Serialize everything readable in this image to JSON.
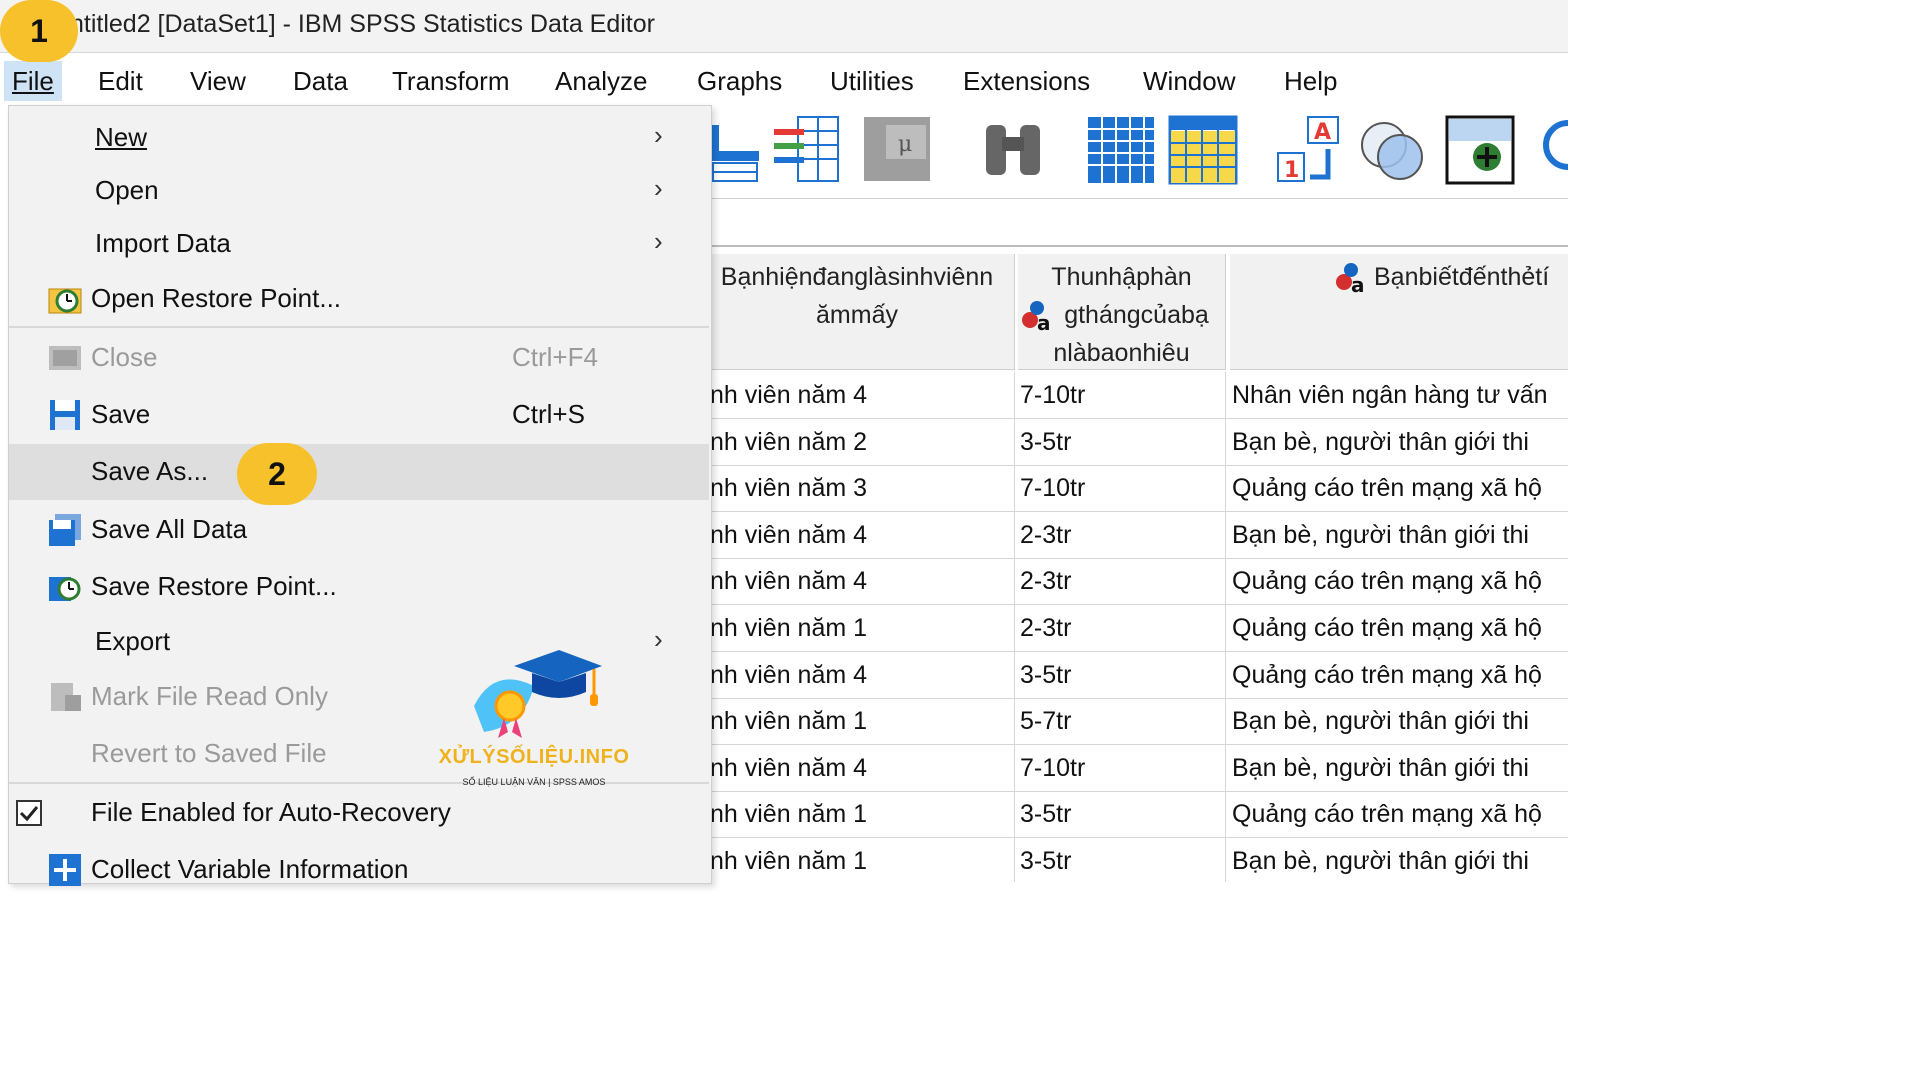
{
  "window": {
    "title": "ntitled2 [DataSet1] - IBM SPSS Statistics Data Editor"
  },
  "badges": {
    "step1": "1",
    "step2": "2"
  },
  "menubar": {
    "items": [
      "File",
      "Edit",
      "View",
      "Data",
      "Transform",
      "Analyze",
      "Graphs",
      "Utilities",
      "Extensions",
      "Window",
      "Help"
    ]
  },
  "toolbar": {
    "icons": [
      "goto-case-icon",
      "variables-icon",
      "custom-tables-icon",
      "find-icon",
      "split-file-icon",
      "select-cases-icon",
      "value-labels-icon",
      "use-sets-icon",
      "spell-check-icon"
    ]
  },
  "file_menu": {
    "new": "New",
    "open": "Open",
    "import_data": "Import Data",
    "open_restore_point": "Open Restore Point...",
    "close": "Close",
    "close_shortcut": "Ctrl+F4",
    "save": "Save",
    "save_shortcut": "Ctrl+S",
    "save_as": "Save As...",
    "save_all_data": "Save All Data",
    "save_restore_point": "Save Restore Point...",
    "export": "Export",
    "mark_read_only": "Mark File Read Only",
    "revert": "Revert to Saved File",
    "auto_recovery": "File Enabled for Auto-Recovery",
    "collect_info": "Collect Variable Information",
    "submenu_arrow": "›"
  },
  "watermark": {
    "title": "XỬLÝSỐLIỆU.INFO",
    "subtitle": "SỐ LIỆU LUẬN VĂN | SPSS AMOS"
  },
  "grid": {
    "headers": [
      "Bạnhiệnđanglàsinhviênnămmấy",
      "Thunhậphàngthángcủabạnlàbaonhiêu",
      "Bạnbiếtđếnthẻtí"
    ],
    "header_lines": {
      "h1": [
        "Bạnhiệnđanglàsinhviênn",
        "ămmấy"
      ],
      "h2": [
        "Thunhậphàn",
        "gthángcủabạ",
        "nlàbaonhiêu"
      ],
      "h3": [
        "Bạnbiếtđếnthẻtí"
      ]
    },
    "rows": [
      [
        "nh viên năm 4",
        "7-10tr",
        "Nhân viên ngân hàng tư vấn"
      ],
      [
        "nh viên năm 2",
        "3-5tr",
        "Bạn bè, người thân giới thi"
      ],
      [
        "nh viên năm 3",
        "7-10tr",
        "Quảng cáo trên mạng xã hộ"
      ],
      [
        "nh viên năm 4",
        "2-3tr",
        "Bạn bè, người thân giới thi"
      ],
      [
        "nh viên năm 4",
        "2-3tr",
        "Quảng cáo trên mạng xã hộ"
      ],
      [
        "nh viên năm 1",
        "2-3tr",
        "Quảng cáo trên mạng xã hộ"
      ],
      [
        "nh viên năm 4",
        "3-5tr",
        "Quảng cáo trên mạng xã hộ"
      ],
      [
        "nh viên năm 1",
        "5-7tr",
        "Bạn bè, người thân giới thi"
      ],
      [
        "nh viên năm 4",
        "7-10tr",
        "Bạn bè, người thân giới thi"
      ],
      [
        "nh viên năm 1",
        "3-5tr",
        "Quảng cáo trên mạng xã hộ"
      ],
      [
        "nh viên năm 1",
        "3-5tr",
        "Bạn bè, người thân giới thi"
      ]
    ]
  }
}
